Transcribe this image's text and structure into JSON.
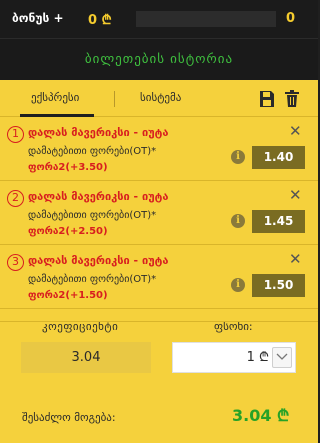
{
  "topbar": {
    "bonus_label": "ბონუს +",
    "bonus_value": "0 ₾",
    "right_value": "0"
  },
  "history_title": "ბილეთების ისტორია",
  "tabs": [
    {
      "label": "ექსპრესი",
      "active": true
    },
    {
      "label": "სისტემა",
      "active": false
    }
  ],
  "icons": {
    "save": "save-icon",
    "trash": "trash-icon",
    "info": "info-icon",
    "close": "close-icon",
    "dropdown": "chevron-down-icon"
  },
  "selections": [
    {
      "num": "1",
      "event": "დალას მავერიკსი - იუტა",
      "market": "დამატებითი ფორები(OT)*",
      "pick": "ფორა2(+3.50)",
      "odds": "1.40"
    },
    {
      "num": "2",
      "event": "დალას მავერიკსი - იუტა",
      "market": "დამატებითი ფორები(OT)*",
      "pick": "ფორა2(+2.50)",
      "odds": "1.45"
    },
    {
      "num": "3",
      "event": "დალას მავერიკსი - იუტა",
      "market": "დამატებითი ფორები(OT)*",
      "pick": "ფორა2(+1.50)",
      "odds": "1.50"
    }
  ],
  "calc": {
    "coef_label": "კოეფიციენტი",
    "stake_label": "ფსონი:",
    "coef_value": "3.04",
    "stake_value": "1 ₾"
  },
  "possible_win": {
    "label": "შესაძლო მოგება:",
    "value": "3.04 ₾"
  },
  "colors": {
    "slip_bg": "#f5d13c",
    "accent_red": "#d81f1f",
    "win_green": "#27a227",
    "odds_bg": "#7a6c22"
  }
}
